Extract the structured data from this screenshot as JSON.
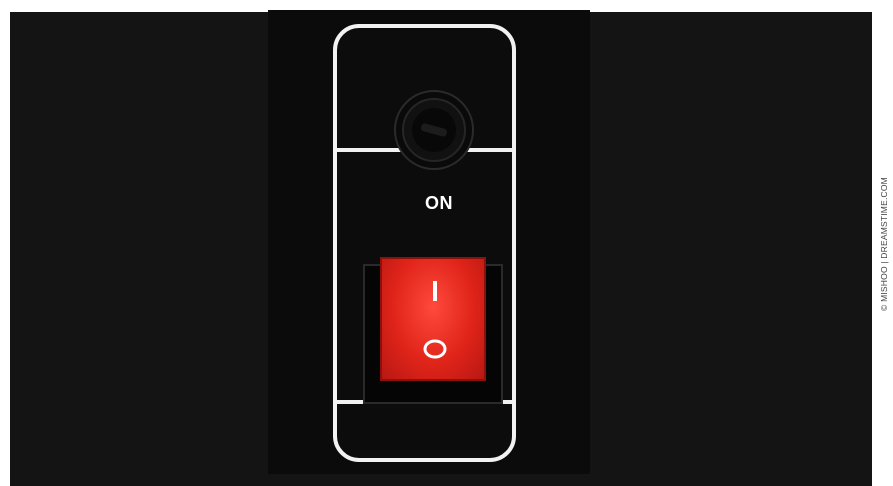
{
  "panel": {
    "switch_label": "ON",
    "switch_marks": {
      "on_symbol": "I",
      "off_symbol": "O"
    },
    "switch_color": "#e0241a",
    "plate_outline_color": "#f2f2f2"
  },
  "watermark": {
    "text": "© MISHOO | DREAMSTIME.COM"
  },
  "icons": {
    "key_lock": "key-lock-icon"
  }
}
